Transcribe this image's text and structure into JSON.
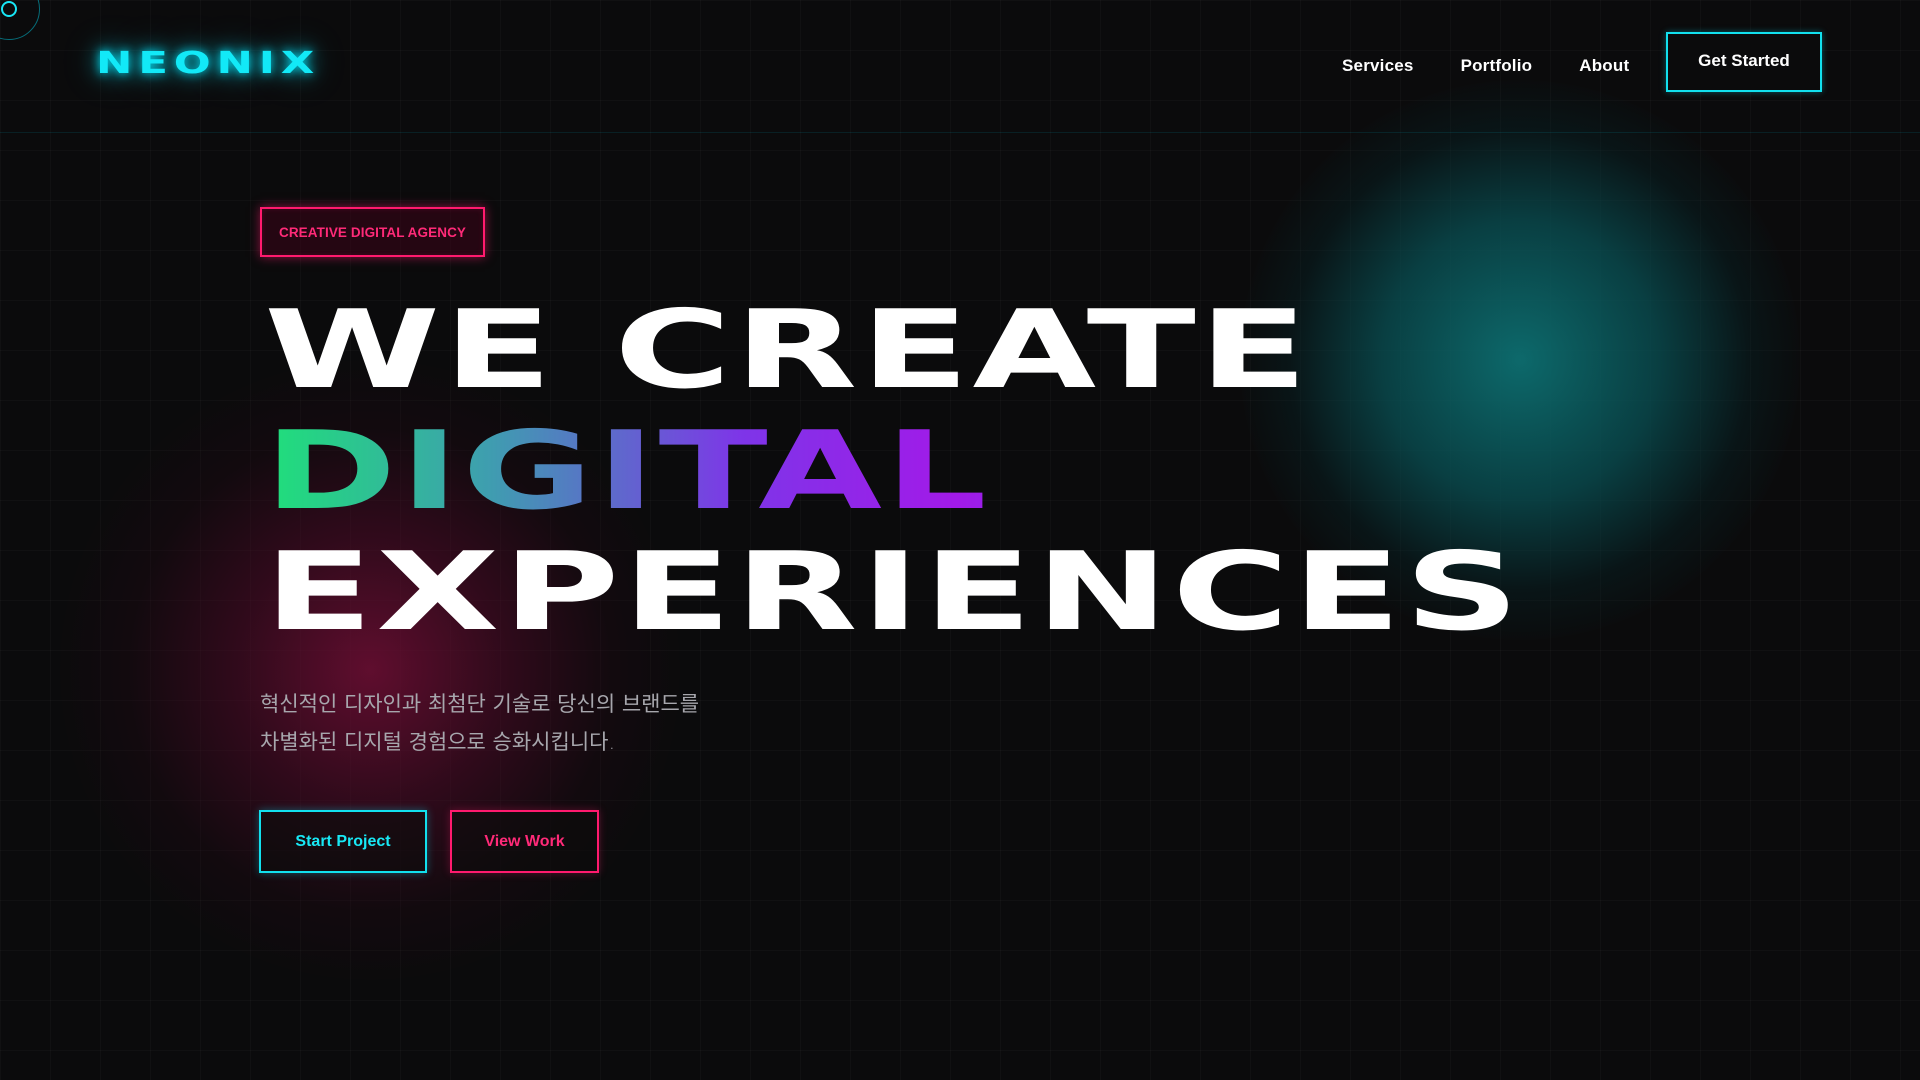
{
  "brand": {
    "logo_text": "NEONIX",
    "accent_cyan": "#12e9f7",
    "accent_magenta": "#ff1a6e"
  },
  "nav": {
    "items": [
      {
        "label": "Services"
      },
      {
        "label": "Portfolio"
      },
      {
        "label": "About"
      }
    ],
    "cta_label": "Get Started"
  },
  "hero": {
    "tag": "CREATIVE DIGITAL AGENCY",
    "headline": {
      "line1": "WE CREATE",
      "line2": "DIGITAL",
      "line3": "EXPERIENCES"
    },
    "description": {
      "line1": "혁신적인 디자인과 최첨단 기술로 당신의 브랜드를",
      "line2": "차별화된 디지털 경험으로 승화시킵니다."
    },
    "buttons": {
      "primary": "Start Project",
      "secondary": "View Work"
    }
  }
}
